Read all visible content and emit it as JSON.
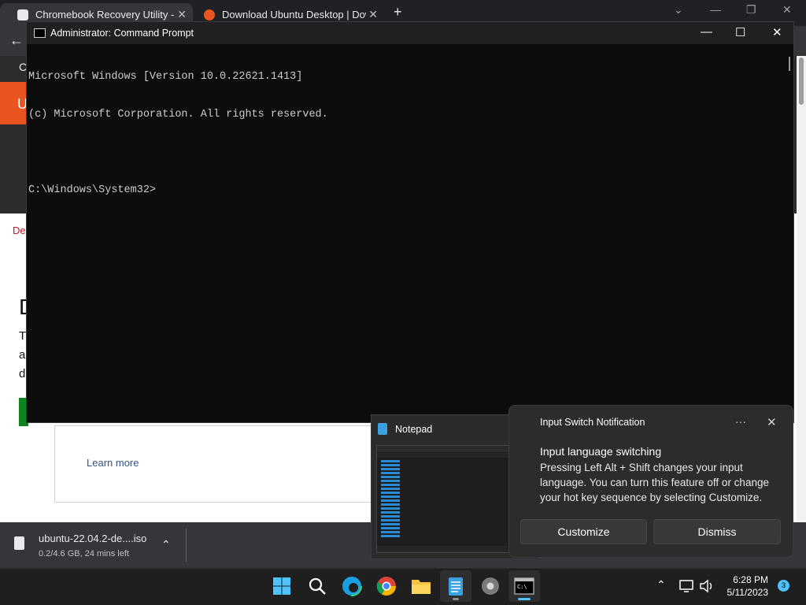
{
  "browser": {
    "tabs": [
      {
        "title": "Chromebook Recovery Utility - C",
        "close": "✕"
      },
      {
        "title": "Download Ubuntu Desktop | Dow",
        "close": "✕"
      }
    ],
    "new_tab": "+",
    "window_controls": [
      "⌄",
      "—",
      "❐",
      "✕"
    ],
    "back": "←",
    "page": {
      "nav_char": "C",
      "banner_char": "U",
      "crumb": "De",
      "heading_char": "D",
      "para_chars": [
        "T",
        "a",
        "d"
      ],
      "learn_more": "Learn more"
    }
  },
  "cmd": {
    "title": "Administrator: Command Prompt",
    "controls": [
      "—",
      "☐",
      "✕"
    ],
    "lines": [
      "Microsoft Windows [Version 10.0.22621.1413]",
      "(c) Microsoft Corporation. All rights reserved.",
      "",
      "C:\\Windows\\System32>"
    ]
  },
  "download": {
    "filename": "ubuntu-22.04.2-de....iso",
    "status": "0.2/4.6 GB, 24 mins left",
    "chevron": "⌃"
  },
  "notepad_thumb": {
    "title": "Notepad"
  },
  "toast": {
    "app": "Input Switch Notification",
    "more": "···",
    "close": "✕",
    "heading": "Input language switching",
    "body": "Pressing Left Alt + Shift changes your input language. You can turn this feature off or change your hot key sequence by selecting Customize.",
    "customize": "Customize",
    "dismiss": "Dismiss"
  },
  "taskbar": {
    "icons": [
      "start-icon",
      "search-icon",
      "edge-icon",
      "chrome-icon",
      "file-explorer-icon",
      "notepad-icon",
      "settings-icon",
      "terminal-icon"
    ],
    "tray_chevron": "⌃",
    "time": "6:28 PM",
    "date": "5/11/2023",
    "badge": "3"
  },
  "colors": {
    "ubuntu_orange": "#e95420",
    "accent_blue": "#4cc2ff"
  }
}
